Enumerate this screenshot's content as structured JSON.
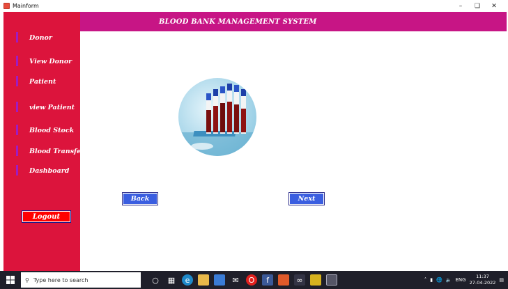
{
  "window": {
    "title": "Mainform"
  },
  "header": {
    "title": "BLOOD BANK MANAGEMENT SYSTEM",
    "bg_color": "#c71585"
  },
  "sidebar": {
    "bg_color": "#dc143c",
    "items": [
      {
        "label": "Donor"
      },
      {
        "label": "View Donor"
      },
      {
        "label": "Patient"
      },
      {
        "label": "view Patient"
      },
      {
        "label": "Blood Stock"
      },
      {
        "label": "Blood Transfert"
      },
      {
        "label": "Dashboard"
      }
    ],
    "logout_label": "Logout"
  },
  "main": {
    "image": "blood-sample-tubes-image",
    "back_label": "Back",
    "next_label": "Next",
    "button_color": "#3a5ee0"
  },
  "taskbar": {
    "search_placeholder": "Type here to search",
    "language": "ENG",
    "time": "11:37",
    "date": "27-04-2022"
  }
}
